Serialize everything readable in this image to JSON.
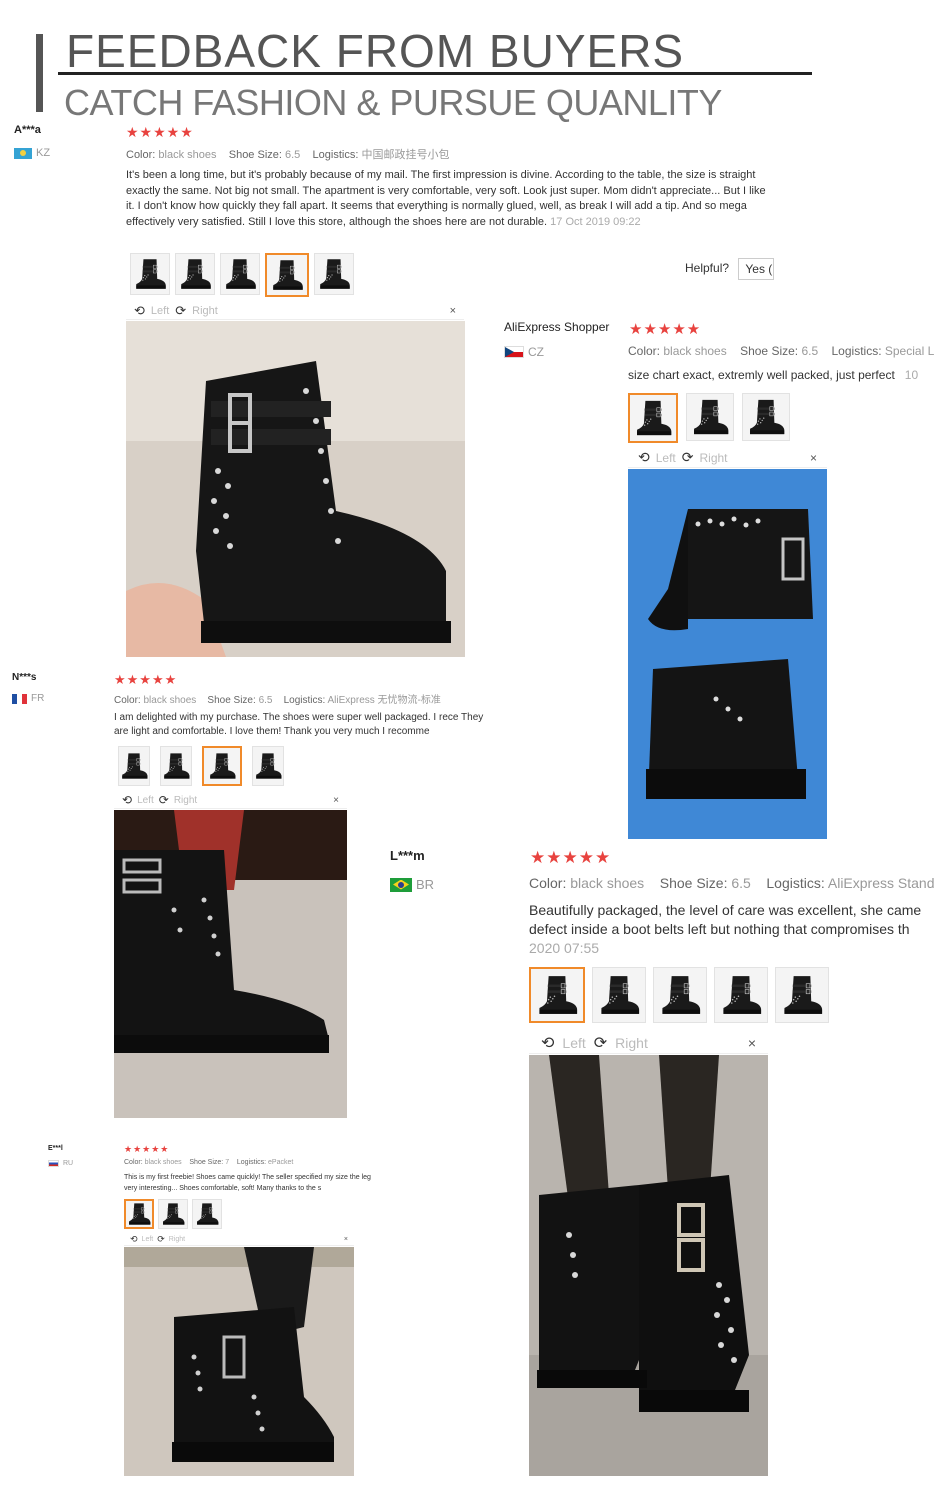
{
  "header": {
    "title": "FEEDBACK FROM BUYERS",
    "subtitle": "CATCH FASHION & PURSUE QUANLITY"
  },
  "reviews": [
    {
      "name": "A***a",
      "country": "KZ",
      "stars": "★★★★★",
      "color_label": "Color:",
      "color_value": "black shoes",
      "size_label": "Shoe Size:",
      "size_value": "6.5",
      "logistics_label": "Logistics:",
      "logistics_value": "中国邮政挂号小包",
      "text": "It's been a long time, but it's probably because of my mail. The first impression is divine. According to the table, the size is straight exactly the same. Not big not small. The apartment is very comfortable, very soft. Look just super. Mom didn't appreciate... But I like it. I don't know how quickly they fall apart. It seems that everything is normally glued, well, as break I will add a tip. And so mega effectively very satisfied. Still I love this store, although the shoes here are not durable.",
      "date": "17 Oct 2019 09:22",
      "helpful_label": "Helpful?",
      "yes_label": "Yes ("
    },
    {
      "name": "AliExpress Shopper",
      "country": "CZ",
      "stars": "★★★★★",
      "color_label": "Color:",
      "color_value": "black shoes",
      "size_label": "Shoe Size:",
      "size_value": "6.5",
      "logistics_label": "Logistics:",
      "logistics_value": "Special L",
      "text": "size chart exact, extremly well packed, just perfect",
      "date": "10"
    },
    {
      "name": "N***s",
      "country": "FR",
      "stars": "★★★★★",
      "color_label": "Color:",
      "color_value": "black shoes",
      "size_label": "Shoe Size:",
      "size_value": "6.5",
      "logistics_label": "Logistics:",
      "logistics_value": "AliExpress 无忧物流-标准",
      "text": "I am delighted with my purchase. The shoes were super well packaged. I rece They are light and comfortable. I love them! Thank you very much I recomme"
    },
    {
      "name": "L***m",
      "country": "BR",
      "stars": "★★★★★",
      "color_label": "Color:",
      "color_value": "black shoes",
      "size_label": "Shoe Size:",
      "size_value": "6.5",
      "logistics_label": "Logistics:",
      "logistics_value": "AliExpress Stand",
      "text": "Beautifully packaged, the level of care was excellent, she came defect inside a boot belts left but nothing that compromises th",
      "date": "2020 07:55"
    },
    {
      "name": "E***l",
      "country": "RU",
      "stars": "★★★★★",
      "color_label": "Color:",
      "color_value": "black shoes",
      "size_label": "Shoe Size:",
      "size_value": "7",
      "logistics_label": "Logistics:",
      "logistics_value": "ePacket",
      "text": "This is my first freebie! Shoes came quickly! The seller specified my size the leg very interesting... Shoes comfortable, soft! Many thanks to the s"
    }
  ],
  "viewer": {
    "left_label": "Left",
    "right_label": "Right",
    "close_label": "×",
    "rotate_left_icon": "⟲",
    "rotate_right_icon": "⟳"
  },
  "colors": {
    "star": "#e8433f",
    "selected_thumb": "#f08a2a",
    "header_text": "#555555"
  }
}
